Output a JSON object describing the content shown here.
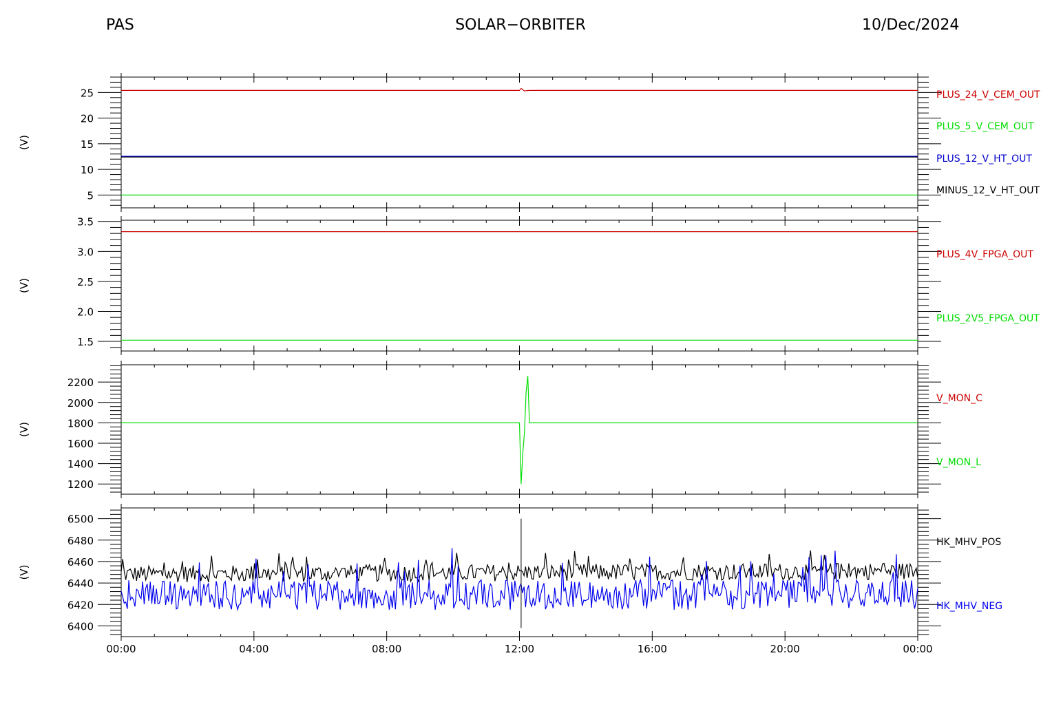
{
  "header": {
    "left": "PAS",
    "center": "SOLAR−ORBITER",
    "right": "10/Dec/2024"
  },
  "chart_data": [
    {
      "type": "line",
      "ylabel": "(V)",
      "ylim": [
        2.5,
        28
      ],
      "yticks": [
        5,
        10,
        15,
        20,
        25
      ],
      "series": [
        {
          "name": "PLUS_24_V_CEM_OUT",
          "color": "#cc0000",
          "x": [
            0,
            12,
            12.05,
            12.15,
            12.3,
            24
          ],
          "y": [
            25.4,
            25.4,
            25.8,
            25.3,
            25.4,
            25.4
          ]
        },
        {
          "name": "PLUS_5_V_CEM_OUT",
          "color": "#00dd00",
          "x": [
            0,
            24
          ],
          "y": [
            5.0,
            5.0
          ]
        },
        {
          "name": "PLUS_12_V_HT_OUT",
          "color": "#0000cc",
          "x": [
            0,
            24
          ],
          "y": [
            12.5,
            12.5
          ]
        },
        {
          "name": "MINUS_12_V_HT_OUT",
          "color": "#000000",
          "x": [
            0,
            24
          ],
          "y": [
            12.4,
            12.4
          ]
        }
      ]
    },
    {
      "type": "line",
      "ylabel": "(V)",
      "ylim": [
        1.34,
        3.52
      ],
      "yticks": [
        1.5,
        2.0,
        2.5,
        3.0,
        3.5
      ],
      "series": [
        {
          "name": "PLUS_4V_FPGA_OUT",
          "color": "#cc0000",
          "x": [
            0,
            24
          ],
          "y": [
            3.33,
            3.33
          ]
        },
        {
          "name": "PLUS_2V5_FPGA_OUT",
          "color": "#00dd00",
          "x": [
            0,
            24
          ],
          "y": [
            1.52,
            1.52
          ]
        }
      ]
    },
    {
      "type": "line",
      "ylabel": "(V)",
      "ylim": [
        1100,
        2370
      ],
      "yticks": [
        1200,
        1400,
        1600,
        1800,
        2000,
        2200
      ],
      "series": [
        {
          "name": "V_MON_C",
          "color": "#cc0000",
          "x": [],
          "y": []
        },
        {
          "name": "V_MON_L",
          "color": "#00dd00",
          "x": [
            0,
            12.0,
            12.05,
            12.1,
            12.15,
            12.2,
            12.25,
            12.3,
            24
          ],
          "y": [
            1800,
            1800,
            1200,
            1500,
            1700,
            2100,
            2260,
            1800,
            1800
          ]
        }
      ]
    },
    {
      "type": "line",
      "ylabel": "(V)",
      "ylim": [
        6390,
        6510
      ],
      "yticks": [
        6400,
        6420,
        6440,
        6460,
        6480,
        6500
      ],
      "series": [
        {
          "name": "HK_MHV_POS",
          "color": "#000000",
          "x": [
            0,
            24
          ],
          "y": [
            6445,
            6448
          ]
        },
        {
          "name": "HK_MHV_NEG",
          "color": "#0000ee",
          "x": [
            0,
            24
          ],
          "y": [
            6422,
            6422
          ]
        }
      ]
    }
  ],
  "xaxis": {
    "xlim": [
      0,
      24
    ],
    "ticks": [
      0,
      4,
      8,
      12,
      16,
      20,
      24
    ],
    "ticklabels": [
      "00:00",
      "04:00",
      "08:00",
      "12:00",
      "16:00",
      "20:00",
      "00:00"
    ]
  }
}
